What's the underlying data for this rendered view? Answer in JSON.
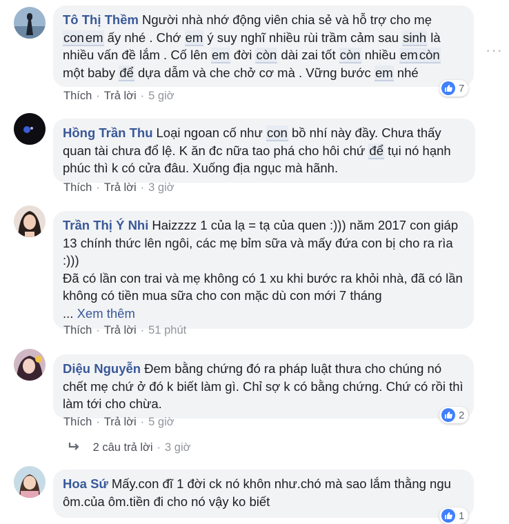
{
  "comments": [
    {
      "author": "Tô Thị Thềm",
      "text_parts": [
        {
          "t": "Người nhà nhớ động viên chia sẻ và hỗ trợ cho mẹ "
        },
        {
          "t": "con",
          "hl": true
        },
        {
          "t": "em",
          "hl": true
        },
        {
          "t": " ấy nhé . Chớ "
        },
        {
          "t": "em",
          "hl": true
        },
        {
          "t": " ý suy nghĩ nhiều rùi trầm cảm sau "
        },
        {
          "t": "sinh",
          "hl": true
        },
        {
          "t": " là nhiều vấn đề lắm . Cố lên "
        },
        {
          "t": "em",
          "hl": true
        },
        {
          "t": " đời "
        },
        {
          "t": "còn",
          "hl": true
        },
        {
          "t": " dài zai tốt "
        },
        {
          "t": "còn",
          "hl": true
        },
        {
          "t": " nhiều "
        },
        {
          "t": "em",
          "hl": true
        },
        {
          "t": "còn",
          "hl": true
        },
        {
          "t": " một baby "
        },
        {
          "t": "để",
          "hl": true
        },
        {
          "t": " dựa dẫm và che chở cơ mà . Vững bước "
        },
        {
          "t": "em",
          "hl": true
        },
        {
          "t": " nhé"
        }
      ],
      "like": "Thích",
      "reply": "Trả lời",
      "time": "5 giờ",
      "reactions": "7"
    },
    {
      "author": "Hồng Trần Thu",
      "text_parts": [
        {
          "t": "Loại ngoan cố như "
        },
        {
          "t": "con",
          "hl": true
        },
        {
          "t": " bồ nhí này đầy. Chưa thấy quan tài chưa đổ lệ. K ăn đc nữa tao phá cho hôi chứ "
        },
        {
          "t": "để",
          "hl": true
        },
        {
          "t": " tụi nó hạnh phúc thì k có cửa đâu. Xuống địa ngục mà hãnh."
        }
      ],
      "like": "Thích",
      "reply": "Trả lời",
      "time": "3 giờ"
    },
    {
      "author": "Trần Thị Ý Nhi",
      "text_parts": [
        {
          "t": "Haizzzz 1 của lạ = tạ của quen :))) năm 2017 con giáp 13 chính thức lên ngôi, các mẹ bỉm sữa và mấy đứa con bị cho ra rìa :)))"
        }
      ],
      "text_line2": "Đã có lần con trai và mẹ không có 1 xu khi bước ra khỏi nhà, đã có lần không có tiền mua sữa cho con mặc dù con mới 7 tháng",
      "see_more_prefix": "...",
      "see_more": "Xem thêm",
      "like": "Thích",
      "reply": "Trả lời",
      "time": "51 phút"
    },
    {
      "author": "Diệu Nguyễn",
      "text_parts": [
        {
          "t": "Đem bằng chứng đó ra pháp luật thưa cho chúng nó chết mẹ chứ ở đó k biết làm gì. Chỉ sợ k có bằng chứng. Chứ có rồi thì làm tới cho chừa."
        }
      ],
      "like": "Thích",
      "reply": "Trả lời",
      "time": "5 giờ",
      "reactions": "2",
      "replies_label": "2 câu trả lời",
      "replies_time": "3 giờ"
    },
    {
      "author": "Hoa Sứ",
      "text_parts": [
        {
          "t": "Mấy.con đĩ 1 đời ck nó khôn như.chó mà sao lắm thằng ngu ôm.của ôm.tiền đi cho nó vậy ko biết"
        }
      ],
      "reactions": "1"
    }
  ],
  "colors": {
    "name": "#385898",
    "bubble": "#f2f3f5",
    "like_blue": "#4080ff",
    "meta": "#90949c"
  },
  "icons": {
    "like": "thumbs-up-icon",
    "reply_arrow": "reply-arrow-icon",
    "more": "more-dots-icon"
  }
}
